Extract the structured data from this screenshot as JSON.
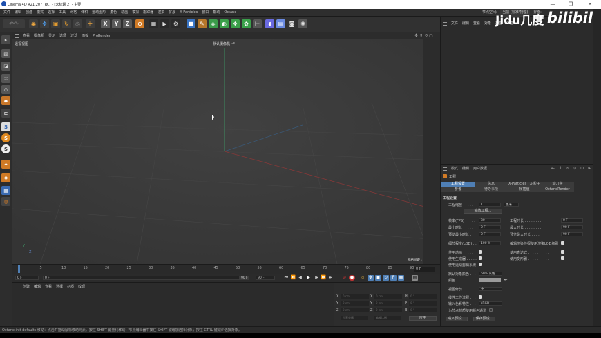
{
  "titlebar": {
    "title": "Cinema 4D R21.207 (RC) - [未标题 2] - 主要",
    "min": "—",
    "max": "❐",
    "close": "✕"
  },
  "menu": [
    "文件",
    "编辑",
    "创建",
    "模式",
    "选择",
    "工具",
    "网格",
    "体积",
    "运动图形",
    "角色",
    "动画",
    "模拟",
    "跟踪器",
    "渲染",
    "扩展",
    "X-Particles",
    "窗口",
    "帮助",
    "Octane"
  ],
  "layout_menu": {
    "label": "节点空间:",
    "value": "当前 (标准/物理)",
    "layout_label": "界面:"
  },
  "viewport_menu": [
    "查看",
    "摄像机",
    "显示",
    "选项",
    "过滤",
    "面板",
    "ProRender"
  ],
  "viewport": {
    "name": "透视视图",
    "camera": "默认摄像机 •°",
    "grid_label": "网格间距 : 100 cm",
    "axis_y": "Y",
    "axis_z": "Z"
  },
  "timeline": {
    "ticks": [
      "0",
      "5",
      "10",
      "15",
      "20",
      "25",
      "30",
      "35",
      "40",
      "45",
      "50",
      "55",
      "60",
      "65",
      "70",
      "75",
      "80",
      "85",
      "90"
    ],
    "end_frame": "0 F"
  },
  "transport": {
    "start": "0 F",
    "current": "0 F",
    "end1": "90 F",
    "end2": "90 F"
  },
  "material_menu": [
    "创建",
    "编辑",
    "查看",
    "选择",
    "材质",
    "纹理"
  ],
  "coords": {
    "pos_labels": [
      "X",
      "Y",
      "Z"
    ],
    "size_labels": [
      "X",
      "Y",
      "Z"
    ],
    "rot_labels": [
      "H",
      "P",
      "B"
    ],
    "values": [
      "0 cm",
      "0 cm",
      "0 cm",
      "0 cm",
      "0 cm",
      "0 cm",
      "0 °",
      "0 °",
      "0 °"
    ],
    "mode1": "世界坐标",
    "mode2": "缩放比例",
    "apply": "应用"
  },
  "object_manager": {
    "menu": [
      "文件",
      "编辑",
      "查看",
      "对象",
      "标签",
      "书签"
    ]
  },
  "watermark": {
    "text1": "Jidu几度",
    "text2": "bilibili"
  },
  "attr_manager": {
    "menu": [
      "模式",
      "编辑",
      "用户数据"
    ],
    "title": "工程",
    "tabs_row1": [
      "工程设置",
      "信息",
      "X-Particles | X-粒子",
      "动力学"
    ],
    "tabs_row2": [
      "参考",
      "待办事项",
      "帧插值",
      "OctaneRender"
    ],
    "section": "工程设置",
    "scale_label": "工程缩放 . . . . . . .",
    "scale_value": "1",
    "scale_unit": "厘米",
    "scale_button": "缩放工程...",
    "fps_label": "帧率(FPS) . . . . .",
    "fps_value": "30",
    "min_time_label": "最小时长 . . . . . .",
    "min_time_value": "0 F",
    "preview_min_label": "预览最小时长 . .",
    "preview_min_value": "0 F",
    "lod_label": "细节程度(LOD) . .",
    "lod_value": "100 %",
    "project_time_label": "工程时长 . . . . . . . .",
    "project_time_value": "0 F",
    "max_time_label": "最大时长 . . . . . . . .",
    "max_time_value": "90 F",
    "preview_max_label": "预览最大时长 . . . .",
    "preview_max_value": "90 F",
    "render_lod_label": "编辑渲染检视使用渲染LOD级别",
    "use_anim_label": "使用动画 . . . . . . .",
    "use_gen_label": "使用生成器 . . . . .",
    "use_motion_label": "使用运动剪辑系统",
    "use_expr_label": "使用表达式 . . . . . . . . . .",
    "use_deform_label": "使用变形器 . . . . . . . . . .",
    "default_color_label": "默认对象颜色 . . .",
    "default_color_value": "60% 灰色",
    "color_label": "颜色 . . . . . . . . . . . . .",
    "view_correction_label": "视图修剪 . . . . . .",
    "view_correction_value": "中",
    "linear_label": "线性工作流程 . . .",
    "input_color_label": "输入色彩特性 . . .",
    "input_color_value": "sRGB",
    "node_color_label": "为节点材质使用颜色通道",
    "load_preset": "载入预设...",
    "save_preset": "保存预设..."
  },
  "statusbar": {
    "text": "Octane:init defaults    移动：点击并拖动鼠标移动元素。按住 SHIFT 键量化移动；节点编辑器中按住 SHIFT 键增加选择对象；按住 CTRL 键减少选择对象。"
  },
  "colors": {
    "accent_tab": "#4f7fb5",
    "grid_green": "#3fa06a",
    "grid_red": "#b04040",
    "icon_blue": "#3a75c4",
    "icon_orange": "#e07b22"
  }
}
